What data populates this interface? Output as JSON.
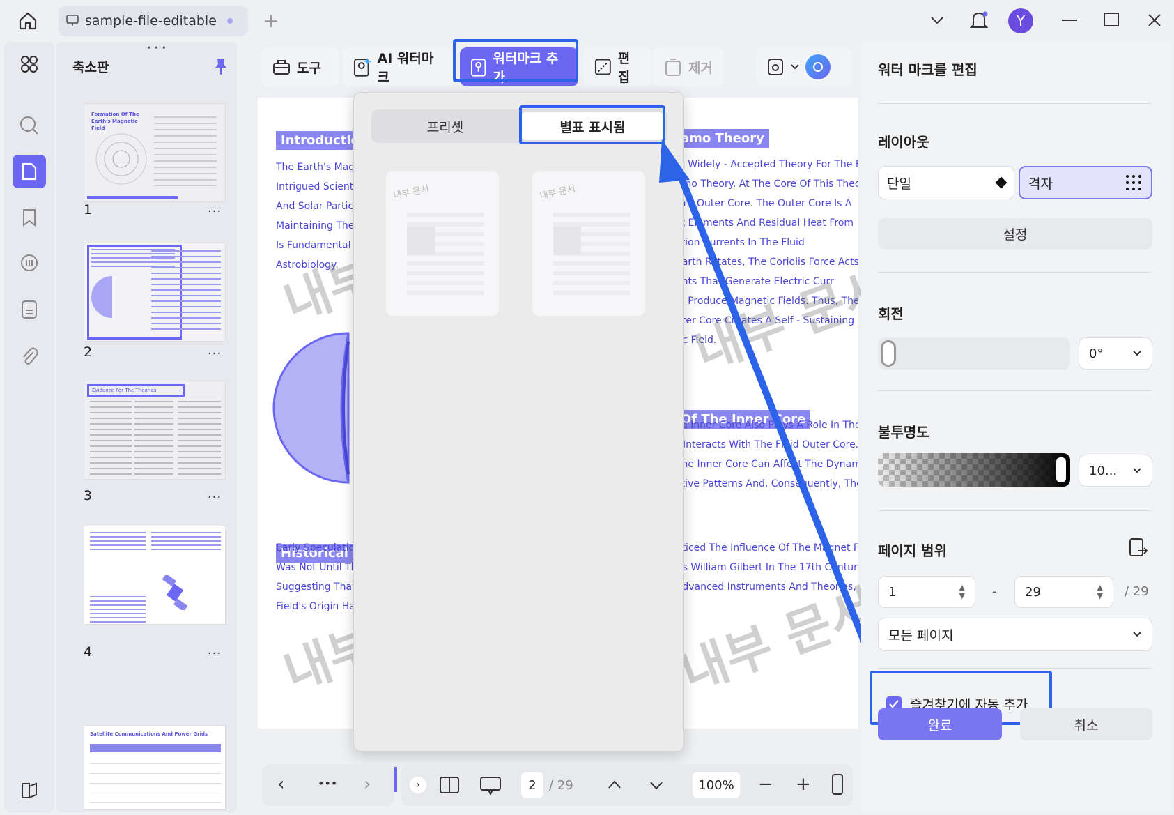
{
  "titlebar": {
    "home_icon": "home-icon",
    "tab_title": "sample-file-editable",
    "new_tab_icon": "plus-icon",
    "avatar_letter": "Y"
  },
  "thumbs_panel": {
    "title": "축소판",
    "pages": [
      {
        "num": "1",
        "caption": "Formation Of The Earth's Magnetic Field"
      },
      {
        "num": "2",
        "caption": ""
      },
      {
        "num": "3",
        "caption": "Evidence For The Theories"
      },
      {
        "num": "4",
        "caption": ""
      },
      {
        "num": "",
        "caption": "Satellite Communications And Power Grids"
      }
    ],
    "more": "..."
  },
  "toolbar": {
    "tools_label": "도구",
    "ai_watermark_label": "AI 워터마크",
    "add_watermark_label": "워터마크 추가",
    "edit_label": "편집",
    "remove_label": "제거"
  },
  "popup": {
    "seg_preset": "프리셋",
    "seg_favorites": "별표 표시됨",
    "preview_text": "내부 문서"
  },
  "document": {
    "headings": [
      "Introduction",
      "amo Theory",
      "Of The Inner Core",
      "Historical Pe"
    ],
    "left_lines_1": [
      "The Earth's Magn",
      "Intrigued Scientist",
      "And Solar Particle",
      "Maintaining The S",
      "Is Fundamental T",
      "Astrobiology."
    ],
    "right_lines_1": [
      "st Widely - Accepted Theory For The Fo",
      "amo Theory. At The Core Of This Theo",
      "th's Outer Core. The Outer Core Is A",
      "ct Elements And Residual Heat From",
      "ction Currents In The Fluid",
      "Earth Rotates, The Coriolis Force Acts",
      "ents That Generate Electric Curr",
      "ts Produce Magnetic Fields. Thus, The C",
      "uter Core Creates A Self - Sustaining Dy",
      "tic Field."
    ],
    "right_lines_2": [
      "lid Inner Core Also Plays A Role In The",
      "t Interacts With The Fluid Outer Core. Th",
      "The Inner Core Can Affect The Dynamic",
      "ctive Patterns And, Consequently, The M"
    ],
    "left_lines_2": [
      "Early Speculation",
      "Was Not Until The",
      "Suggesting That T",
      "Field's Origin Ha"
    ],
    "right_lines_3": [
      "oticed The Influence Of The Magnet Fi",
      "As William Gilbert In The 17th Century",
      "Advanced Instruments And Theories, Ou"
    ],
    "watermark": "내부 문서"
  },
  "right_panel": {
    "title": "워터 마크를 편집",
    "layout_label": "레이아웃",
    "layout_single": "단일",
    "layout_grid": "격자",
    "settings_label": "설정",
    "rotation_label": "회전",
    "rotation_value": "0°",
    "opacity_label": "불투명도",
    "opacity_value": "10...",
    "page_range_label": "페이지 범위",
    "range_from": "1",
    "range_dash": "-",
    "range_to": "29",
    "range_total": "/ 29",
    "page_select": "모든 페이지",
    "auto_fav_label": "즐겨찾기에 자동 추가",
    "auto_fav_checked": true,
    "done_label": "완료",
    "cancel_label": "취소"
  },
  "bottom_bar": {
    "page_current": "2",
    "page_total": "/ 29",
    "zoom": "100%"
  },
  "colors": {
    "accent": "#6b67f2",
    "highlight": "#2d63e8",
    "doc_text": "#4b47d6"
  }
}
